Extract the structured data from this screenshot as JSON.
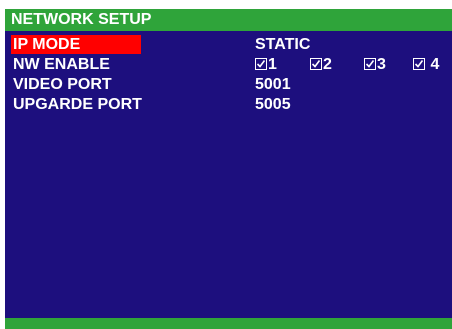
{
  "title": "NETWORK SETUP",
  "rows": [
    {
      "label": "IP MODE",
      "value": "STATIC"
    },
    {
      "label": "NW ENABLE",
      "checkboxes": [
        {
          "label": "1",
          "checked": true
        },
        {
          "label": "2",
          "checked": true
        },
        {
          "label": "3",
          "checked": true
        },
        {
          "label": "4",
          "checked": true
        }
      ]
    },
    {
      "label": "VIDEO PORT",
      "value": "5001"
    },
    {
      "label": "UPGARDE PORT",
      "value": "5005"
    }
  ],
  "colors": {
    "panel": "#1d0f7e",
    "title_bar": "#2fa43a",
    "selection": "#ff0000",
    "text": "#ffffff"
  }
}
